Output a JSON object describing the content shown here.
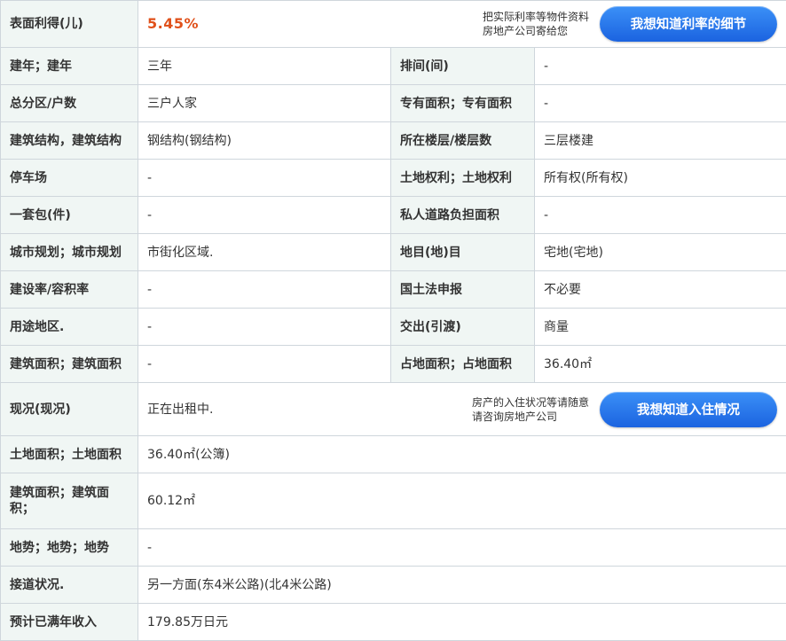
{
  "rows": {
    "yield": {
      "label": "表面利得(儿)",
      "value": "5.45%",
      "note_line1": "把实际利率等物件资料",
      "note_line2": "房地产公司寄给您",
      "button": "我想知道利率的细节"
    },
    "r1": {
      "l1": "建年；建年",
      "v1": "三年",
      "l2": "排间(间)",
      "v2": "-"
    },
    "r2": {
      "l1": "总分区/户数",
      "v1": "三户人家",
      "l2": "专有面积；专有面积",
      "v2": "-"
    },
    "r3": {
      "l1": "建筑结构，建筑结构",
      "v1": "钢结构(钢结构)",
      "l2": "所在楼层/楼层数",
      "v2": "三层楼建"
    },
    "r4": {
      "l1": "停车场",
      "v1": "-",
      "l2": "土地权利；土地权利",
      "v2": "所有权(所有权)"
    },
    "r5": {
      "l1": "一套包(件)",
      "v1": "-",
      "l2": "私人道路负担面积",
      "v2": "-"
    },
    "r6": {
      "l1": "城市规划；城市规划",
      "v1": "市街化区域.",
      "l2": "地目(地)目",
      "v2": "宅地(宅地)"
    },
    "r7": {
      "l1": "建设率/容积率",
      "v1": "-",
      "l2": "国土法申报",
      "v2": "不必要"
    },
    "r8": {
      "l1": "用途地区.",
      "v1": "-",
      "l2": "交出(引渡)",
      "v2": "商量"
    },
    "r9": {
      "l1": "建筑面积；建筑面积",
      "v1": "-",
      "l2": "占地面积；占地面积",
      "v2": "36.40㎡"
    },
    "status": {
      "label": "现况(现况)",
      "value": "正在出租中.",
      "note_line1": "房产的入住状况等请随意",
      "note_line2": "请咨询房地产公司",
      "button": "我想知道入住情况"
    },
    "r10": {
      "label": "土地面积；土地面积",
      "value": "36.40㎡(公簿)"
    },
    "r11": {
      "label": "建筑面积；建筑面积；",
      "value": "60.12㎡"
    },
    "r12": {
      "label": "地势；地势；地势",
      "value": "-"
    },
    "r13": {
      "label": "接道状况.",
      "value": "另一方面(东4米公路)(北4米公路)"
    },
    "r14": {
      "label": "预计已满年收入",
      "value": "179.85万日元"
    }
  }
}
